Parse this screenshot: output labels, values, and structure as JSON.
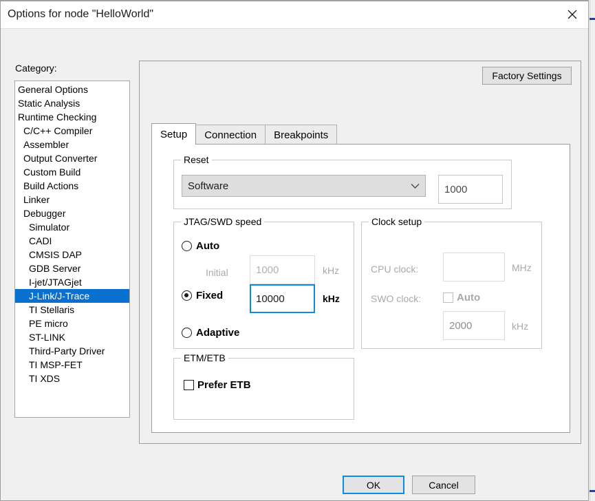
{
  "window": {
    "title": "Options for node \"HelloWorld\"",
    "close_icon": "close-icon"
  },
  "category": {
    "label": "Category:",
    "items": [
      {
        "label": "General Options",
        "indent": 0,
        "selected": false
      },
      {
        "label": "Static Analysis",
        "indent": 0,
        "selected": false
      },
      {
        "label": "Runtime Checking",
        "indent": 0,
        "selected": false
      },
      {
        "label": "C/C++ Compiler",
        "indent": 1,
        "selected": false
      },
      {
        "label": "Assembler",
        "indent": 1,
        "selected": false
      },
      {
        "label": "Output Converter",
        "indent": 1,
        "selected": false
      },
      {
        "label": "Custom Build",
        "indent": 1,
        "selected": false
      },
      {
        "label": "Build Actions",
        "indent": 1,
        "selected": false
      },
      {
        "label": "Linker",
        "indent": 1,
        "selected": false
      },
      {
        "label": "Debugger",
        "indent": 1,
        "selected": false
      },
      {
        "label": "Simulator",
        "indent": 2,
        "selected": false
      },
      {
        "label": "CADI",
        "indent": 2,
        "selected": false
      },
      {
        "label": "CMSIS DAP",
        "indent": 2,
        "selected": false
      },
      {
        "label": "GDB Server",
        "indent": 2,
        "selected": false
      },
      {
        "label": "I-jet/JTAGjet",
        "indent": 2,
        "selected": false
      },
      {
        "label": "J-Link/J-Trace",
        "indent": 2,
        "selected": true
      },
      {
        "label": "TI Stellaris",
        "indent": 2,
        "selected": false
      },
      {
        "label": "PE micro",
        "indent": 2,
        "selected": false
      },
      {
        "label": "ST-LINK",
        "indent": 2,
        "selected": false
      },
      {
        "label": "Third-Party Driver",
        "indent": 2,
        "selected": false
      },
      {
        "label": "TI MSP-FET",
        "indent": 2,
        "selected": false
      },
      {
        "label": "TI XDS",
        "indent": 2,
        "selected": false
      }
    ]
  },
  "panel": {
    "factory_settings_label": "Factory Settings",
    "tabs": [
      {
        "label": "Setup",
        "active": true
      },
      {
        "label": "Connection",
        "active": false
      },
      {
        "label": "Breakpoints",
        "active": false
      }
    ]
  },
  "reset": {
    "group_title": "Reset",
    "mode_selected": "Software",
    "dropdown_icon": "chevron-down-icon",
    "timeout_value": "1000"
  },
  "jtag_swd_speed": {
    "group_title": "JTAG/SWD speed",
    "auto_label": "Auto",
    "auto_selected": false,
    "initial_label": "Initial",
    "initial_value": "1000",
    "initial_unit": "kHz",
    "fixed_label": "Fixed",
    "fixed_selected": true,
    "fixed_value": "10000",
    "fixed_unit": "kHz",
    "adaptive_label": "Adaptive",
    "adaptive_selected": false
  },
  "clock_setup": {
    "group_title": "Clock setup",
    "cpu_clock_label": "CPU clock:",
    "cpu_clock_value": "",
    "cpu_clock_unit": "MHz",
    "swo_clock_label": "SWO clock:",
    "swo_auto_label": "Auto",
    "swo_auto_checked": false,
    "swo_clock_value": "2000",
    "swo_clock_unit": "kHz"
  },
  "etm_etb": {
    "group_title": "ETM/ETB",
    "prefer_etb_label": "Prefer ETB",
    "prefer_etb_checked": false
  },
  "footer": {
    "ok_label": "OK",
    "cancel_label": "Cancel"
  },
  "colors": {
    "selection_blue": "#0a70d0",
    "focus_blue": "#0a8bde",
    "dialog_bg": "#f0f0f0",
    "panel_bg": "#ffffff"
  }
}
